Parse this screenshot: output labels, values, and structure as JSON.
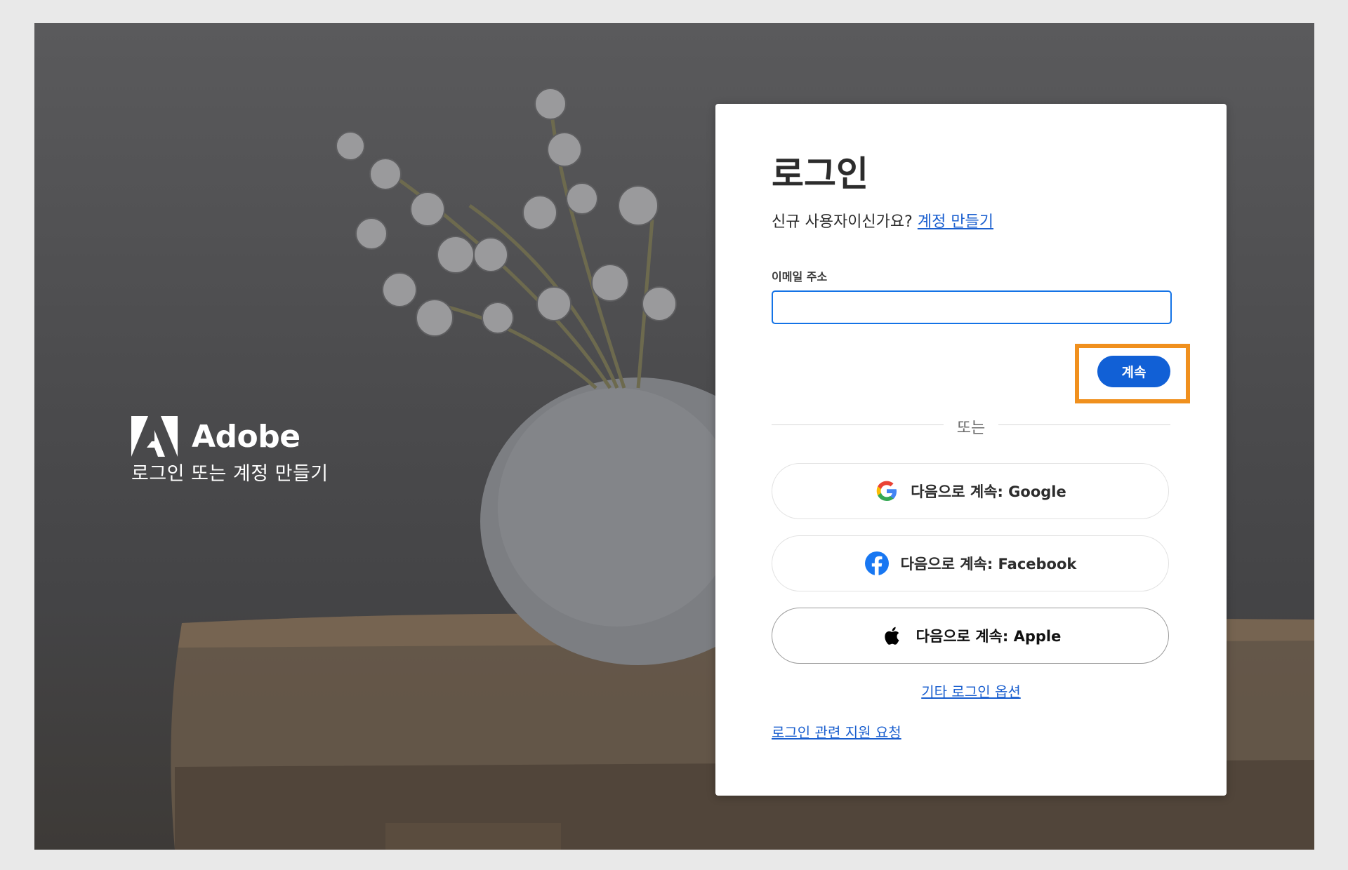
{
  "brand": {
    "name": "Adobe",
    "tagline": "로그인 또는 계정 만들기",
    "logo_icon": "adobe-logo-icon"
  },
  "login": {
    "title": "로그인",
    "signup_prompt": "신규 사용자이신가요?",
    "signup_link": "계정 만들기",
    "email_label": "이메일 주소",
    "email_value": "",
    "continue_button": "계속",
    "divider": "또는",
    "social": [
      {
        "label": "다음으로 계속: Google",
        "icon": "google-icon"
      },
      {
        "label": "다음으로 계속: Facebook",
        "icon": "facebook-icon"
      },
      {
        "label": "다음으로 계속: Apple",
        "icon": "apple-icon"
      }
    ],
    "other_options_link": "기타 로그인 옵션",
    "support_link": "로그인 관련 지원 요청"
  },
  "colors": {
    "accent": "#1160d6",
    "link": "#1a5fcf",
    "highlight": "#f0901e",
    "input_border": "#1473e6"
  }
}
